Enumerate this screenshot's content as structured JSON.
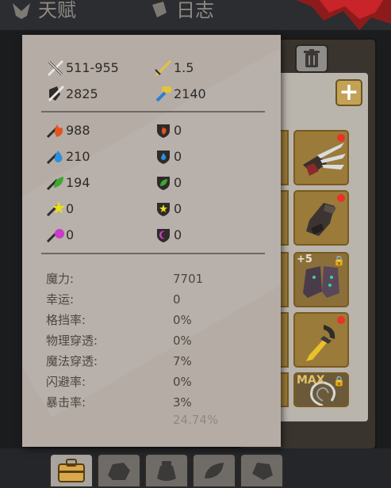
{
  "top_tabs": [
    {
      "label": "天赋",
      "icon": "talent-icon"
    },
    {
      "label": "日志",
      "icon": "log-icon"
    }
  ],
  "attack": {
    "physical_damage": "511-955",
    "attack_speed": "1.5",
    "physical_power": "2825",
    "hammer_power": "2140"
  },
  "elements": [
    {
      "name": "fire",
      "attack": "988",
      "resist": "0",
      "color": "#e3541e"
    },
    {
      "name": "water",
      "attack": "210",
      "resist": "0",
      "color": "#2b8fe0"
    },
    {
      "name": "nature",
      "attack": "194",
      "resist": "0",
      "color": "#3ea833"
    },
    {
      "name": "lightning",
      "attack": "0",
      "resist": "0",
      "color": "#e8e014"
    },
    {
      "name": "arcane",
      "attack": "0",
      "resist": "0",
      "color": "#c83cc8"
    }
  ],
  "stats": [
    {
      "label": "魔力:",
      "value": "7701"
    },
    {
      "label": "幸运:",
      "value": "0"
    },
    {
      "label": "格挡率:",
      "value": "0%"
    },
    {
      "label": "物理穿透:",
      "value": "0%"
    },
    {
      "label": "魔法穿透:",
      "value": "7%"
    },
    {
      "label": "闪避率:",
      "value": "0%"
    },
    {
      "label": "暴击率:",
      "value": "3%"
    },
    {
      "label": "",
      "value": "24.74%"
    }
  ],
  "equipment": [
    {
      "icon": "claw-gauntlet-icon",
      "badge": "",
      "lock": false,
      "new": true
    },
    {
      "icon": "leather-glove-icon",
      "badge": "",
      "lock": false,
      "new": true
    },
    {
      "icon": "boots-icon",
      "badge": "+5",
      "lock": true,
      "new": false
    },
    {
      "icon": "gold-blade-icon",
      "badge": "",
      "lock": false,
      "new": true
    },
    {
      "icon": "vortex-icon",
      "badge": "MAX",
      "lock": true,
      "new": false
    }
  ],
  "bottom_tabs": [
    "bag-icon",
    "rock-icon",
    "pouch-icon",
    "leaf-icon",
    "stone-icon"
  ],
  "colors": {
    "card": "#b4aca5",
    "accent_gold": "#c4a255",
    "alert_red": "#e8322a"
  }
}
